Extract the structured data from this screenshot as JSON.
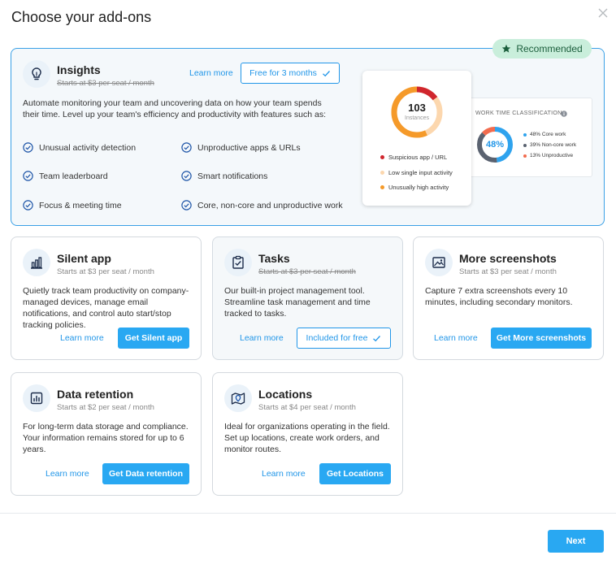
{
  "modal": {
    "title": "Choose your add-ons",
    "next_label": "Next"
  },
  "colors": {
    "accent": "#29a8f2",
    "link": "#2196e8",
    "recommended_bg": "#c9eedb",
    "recommended_text": "#1b5e3c"
  },
  "insights": {
    "title": "Insights",
    "price": "Starts at $3 per seat / month",
    "learn_more": "Learn more",
    "cta": "Free for 3 months",
    "badge": "Recommended",
    "description": "Automate monitoring your team and uncovering data on how your team spends their time. Level up your team's efficiency and productivity with features such as:",
    "features": [
      "Unusual activity detection",
      "Unproductive apps & URLs",
      "Team leaderboard",
      "Smart notifications",
      "Focus & meeting time",
      "Core, non-core and unproductive work"
    ],
    "preview": {
      "instances_value": "103",
      "instances_label": "Instances",
      "legend": [
        {
          "label": "Suspicious app / URL",
          "color": "#d0262d"
        },
        {
          "label": "Low single input activity",
          "color": "#fcd7ae"
        },
        {
          "label": "Unusually high activity",
          "color": "#f59a2a"
        }
      ],
      "work_time": {
        "title": "WORK TIME CLASSIFICATION",
        "percent": "48%",
        "legend": [
          {
            "label": "48% Core work",
            "color": "#2fa3ee"
          },
          {
            "label": "39% Non-core work",
            "color": "#5a6270"
          },
          {
            "label": "13% Unproductive",
            "color": "#f26c4f"
          }
        ]
      }
    }
  },
  "addons": [
    {
      "title": "Silent app",
      "price": "Starts at $3 per seat / month",
      "description": "Quietly track team productivity on company-managed devices, manage email notifications, and control auto start/stop tracking policies.",
      "learn_more": "Learn more",
      "cta": "Get Silent app"
    },
    {
      "title": "Tasks",
      "price": "Starts at $3 per seat / month",
      "description": "Our built-in project management tool. Streamline task management and time tracked to tasks.",
      "learn_more": "Learn more",
      "cta": "Included for free"
    },
    {
      "title": "More screenshots",
      "price": "Starts at $3 per seat / month",
      "description": "Capture 7 extra screenshots every 10 minutes, including secondary monitors.",
      "learn_more": "Learn more",
      "cta": "Get More screenshots"
    },
    {
      "title": "Data retention",
      "price": "Starts at $2 per seat / month",
      "description": "For long-term data storage and compliance. Your information remains stored for up to 6 years.",
      "learn_more": "Learn more",
      "cta": "Get Data retention"
    },
    {
      "title": "Locations",
      "price": "Starts at $4 per seat / month",
      "description": "Ideal for organizations operating in the field. Set up locations, create work orders, and monitor routes.",
      "learn_more": "Learn more",
      "cta": "Get Locations"
    }
  ]
}
